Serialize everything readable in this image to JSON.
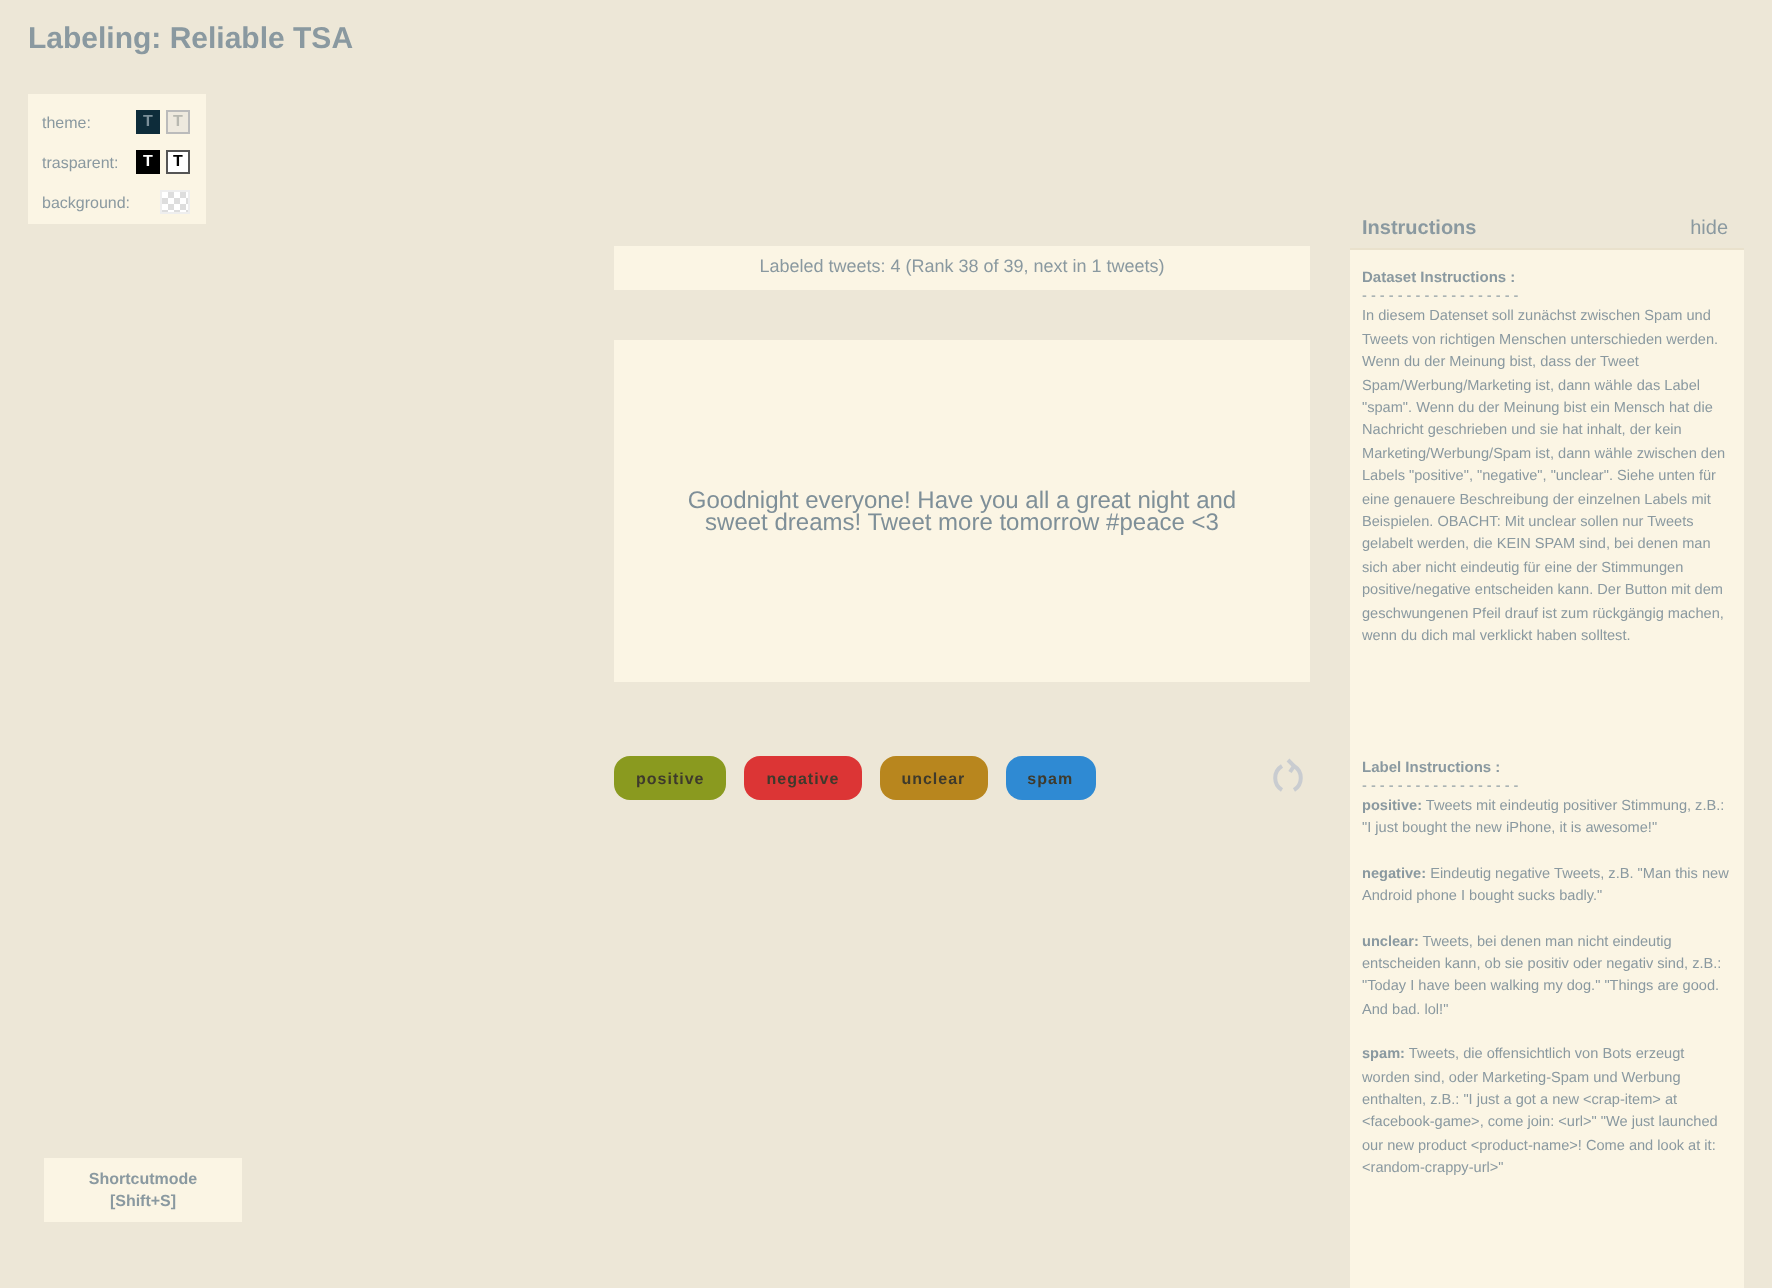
{
  "title": "Labeling: Reliable TSA",
  "settings": [
    {
      "label": "theme:",
      "swatches": [
        {
          "kind": "dark",
          "text": "T"
        },
        {
          "kind": "light",
          "text": "T"
        }
      ]
    },
    {
      "label": "trasparent:",
      "swatches": [
        {
          "kind": "black",
          "text": "T"
        },
        {
          "kind": "white",
          "text": "T"
        }
      ]
    },
    {
      "label": "background:",
      "swatches": [
        {
          "kind": "checker"
        }
      ]
    }
  ],
  "shortcut": {
    "label": "Shortcutmode",
    "key": "[Shift+S]"
  },
  "status": "Labeled tweets: 4 (Rank 38 of 39, next in 1 tweets)",
  "tweet": "Goodnight everyone! Have you all a great night and sweet dreams! Tweet more tomorrow #peace <3",
  "labels": [
    {
      "text": "positive",
      "color": "#8a9a1f"
    },
    {
      "text": "negative",
      "color": "#dc3535"
    },
    {
      "text": "unclear",
      "color": "#b8861e"
    },
    {
      "text": "spam",
      "color": "#2f8ad3"
    }
  ],
  "instructions": {
    "title": "Instructions",
    "hide": "hide",
    "dataset_heading": "Dataset Instructions :",
    "dataset_rule": "- - - - - - - - - - - - - - - - - -",
    "dataset_text": "In diesem Datenset soll zunächst zwischen Spam und Tweets von richtigen Menschen unterschieden werden. Wenn du der Meinung bist, dass der Tweet Spam/Werbung/Marketing ist, dann wähle das Label \"spam\". Wenn du der Meinung bist ein Mensch hat die Nachricht geschrieben und sie hat inhalt, der kein Marketing/Werbung/Spam ist, dann wähle zwischen den Labels \"positive\", \"negative\", \"unclear\". Siehe unten für eine genauere Beschreibung der einzelnen Labels mit Beispielen. OBACHT: Mit unclear sollen nur Tweets gelabelt werden, die KEIN SPAM sind, bei denen man sich aber nicht eindeutig für eine der Stimmungen positive/negative entscheiden kann. Der Button mit dem geschwungenen Pfeil drauf ist zum rückgängig machen, wenn du dich mal verklickt haben solltest.",
    "label_heading": "Label Instructions :",
    "label_rule": "- - - - - - - - - - - - - - - - - -",
    "label_texts": [
      "**positive:** Tweets mit eindeutig positiver Stimmung, z.B.: \"I just bought the new iPhone, it is awesome!\"",
      "**negative:** Eindeutig negative Tweets, z.B. \"Man this new Android phone I bought sucks badly.\"",
      "**unclear:** Tweets, bei denen man nicht eindeutig entscheiden kann, ob sie positiv oder negativ sind, z.B.: \"Today I have been walking my dog.\" \"Things are good. And bad. lol!\"",
      "**spam:** Tweets, die offensichtlich von Bots erzeugt worden sind, oder Marketing-Spam und Werbung enthalten, z.B.: \"I just a got a new <crap-item> at <facebook-game>, come join: <url>\" \"We just launched our new product <product-name>! Come and look at it: <random-crappy-url>\""
    ]
  }
}
